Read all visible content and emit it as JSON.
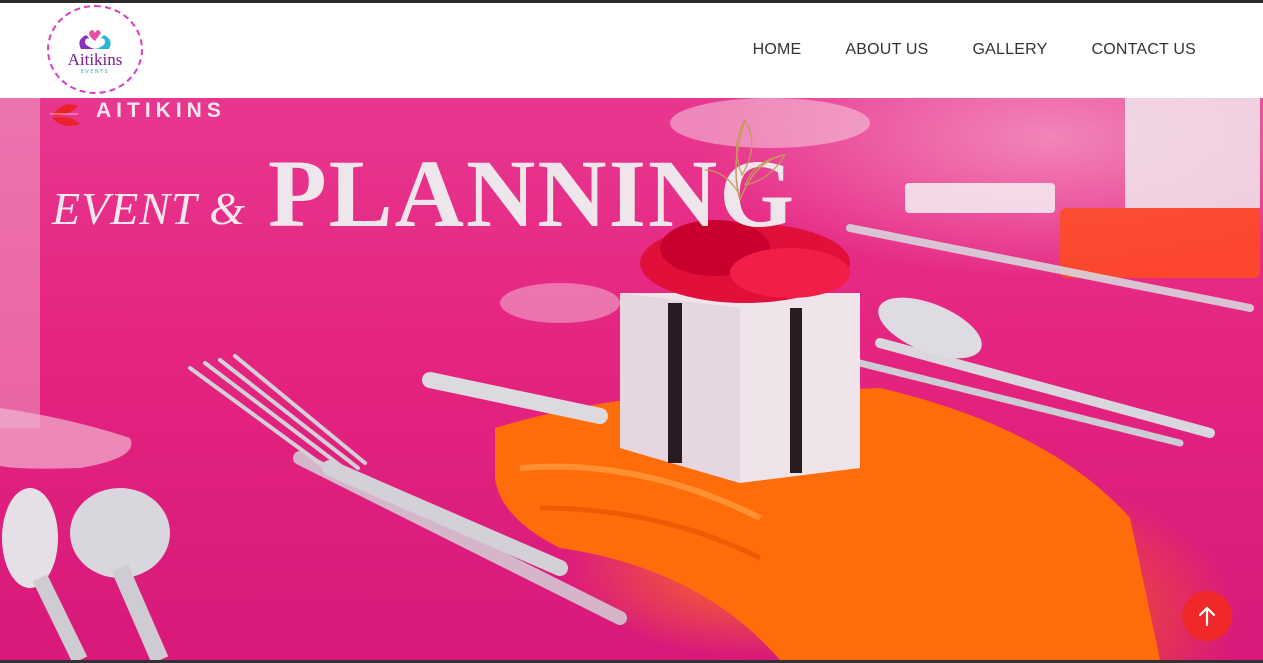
{
  "header": {
    "logo": {
      "name": "Aitikins",
      "sub": "EVENTS"
    },
    "nav": [
      {
        "label": "HOME"
      },
      {
        "label": "ABOUT US"
      },
      {
        "label": "GALLERY"
      },
      {
        "label": "CONTACT US"
      }
    ]
  },
  "hero": {
    "brand": "AITIKINS",
    "headline_prefix": "EVENT &",
    "headline_main": "PLANNING",
    "colors": {
      "tablecloth": "#e5247f",
      "napkin": "#ff6e00",
      "accent": "#f0282a"
    }
  },
  "back_to_top": {
    "icon": "arrow-up-icon"
  }
}
